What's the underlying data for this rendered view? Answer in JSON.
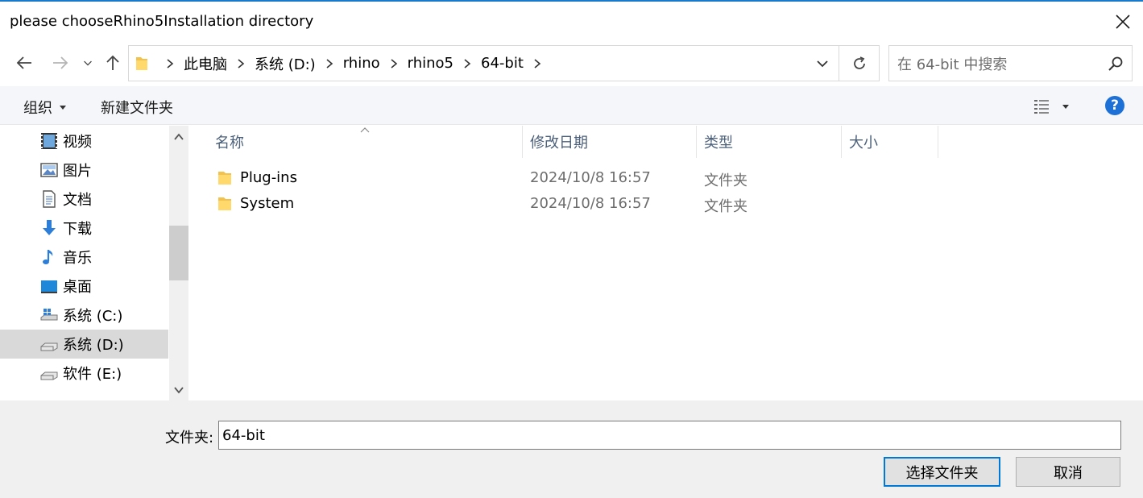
{
  "window": {
    "title": "please chooseRhino5Installation directory",
    "accent": "#0078d7"
  },
  "nav_buttons": {
    "back_icon": "arrow-left-icon",
    "forward_icon": "arrow-right-icon",
    "recent_icon": "chevron-down-icon",
    "up_icon": "arrow-up-icon"
  },
  "address": {
    "crumbs": [
      "此电脑",
      "系统 (D:)",
      "rhino",
      "rhino5",
      "64-bit"
    ]
  },
  "search": {
    "placeholder": "在 64-bit 中搜索"
  },
  "toolbar": {
    "organize_label": "组织",
    "new_folder_label": "新建文件夹",
    "help_label": "?"
  },
  "nav_pane": {
    "items": [
      {
        "label": "视频",
        "icon": "video-icon"
      },
      {
        "label": "图片",
        "icon": "picture-icon"
      },
      {
        "label": "文档",
        "icon": "document-icon"
      },
      {
        "label": "下载",
        "icon": "download-icon"
      },
      {
        "label": "音乐",
        "icon": "music-icon"
      },
      {
        "label": "桌面",
        "icon": "desktop-icon"
      },
      {
        "label": "系统 (C:)",
        "icon": "windows-drive-icon"
      },
      {
        "label": "系统 (D:)",
        "icon": "drive-icon",
        "selected": true
      },
      {
        "label": "软件 (E:)",
        "icon": "drive-icon"
      }
    ]
  },
  "columns": {
    "name": "名称",
    "date": "修改日期",
    "type": "类型",
    "size": "大小"
  },
  "files": [
    {
      "name": "Plug-ins",
      "date": "2024/10/8 16:57",
      "type": "文件夹",
      "icon": "folder-icon"
    },
    {
      "name": "System",
      "date": "2024/10/8 16:57",
      "type": "文件夹",
      "icon": "folder-icon"
    }
  ],
  "footer": {
    "folder_label": "文件夹:",
    "folder_value": "64-bit",
    "select_button": "选择文件夹",
    "cancel_button": "取消"
  }
}
